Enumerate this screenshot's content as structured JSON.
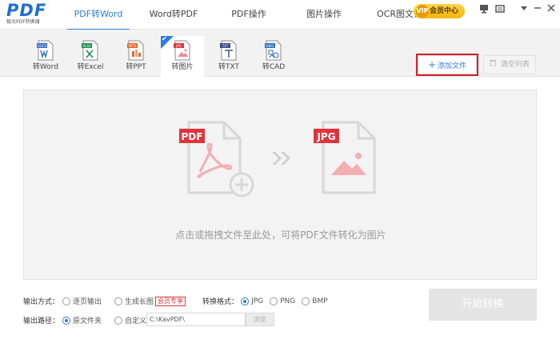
{
  "app": {
    "logo_text": "PDF",
    "logo_sub": "极光PDF转换器"
  },
  "main_tabs": [
    {
      "label": "PDF转Word",
      "active": true
    },
    {
      "label": "Word转PDF",
      "active": false
    },
    {
      "label": "PDF操作",
      "active": false
    },
    {
      "label": "图片操作",
      "active": false
    },
    {
      "label": "OCR图文识别",
      "active": false
    }
  ],
  "vip": {
    "label": "会员中心",
    "icon_text": "VIP"
  },
  "window_controls": {
    "feedback": "▀",
    "message": "✉",
    "menu": "▾",
    "minimize": "—",
    "close": "✕"
  },
  "sub_tabs": [
    {
      "label": "转Word",
      "tag": "DOCX",
      "color": "#2b6cc4",
      "active": false
    },
    {
      "label": "转Excel",
      "tag": "XLSX",
      "color": "#1f8c4a",
      "active": false
    },
    {
      "label": "转PPT",
      "tag": "PPTX",
      "color": "#e06a2b",
      "active": false
    },
    {
      "label": "转图片",
      "tag": "JPG",
      "color": "#e0343c",
      "active": true
    },
    {
      "label": "转TXT",
      "tag": "TXT",
      "color": "#3b4a8a",
      "active": false
    },
    {
      "label": "转CAD",
      "tag": "DWG",
      "color": "#2b6cc4",
      "active": false
    }
  ],
  "toolbar": {
    "add_label": "添加文件",
    "clear_label": "清空列表"
  },
  "drop": {
    "left_tag": "PDF",
    "right_tag": "JPG",
    "hint": "点击或拖拽文件至此处，可将PDF文件转化为图片"
  },
  "options": {
    "output_mode_label": "输出方式：",
    "mode_page": "逐页输出",
    "mode_long": "生成长图",
    "vip_badge": "会员专享",
    "format_label": "转换格式：",
    "format_jpg": "JPG",
    "format_png": "PNG",
    "format_bmp": "BMP",
    "path_label": "输出路径：",
    "path_source": "原文件夹",
    "path_custom": "自定义",
    "path_value": "C:\\KavPDF\\",
    "browse_label": "浏览",
    "start_label": "开始转换"
  },
  "colors": {
    "accent": "#2d7be5",
    "highlight_border": "#d8202a",
    "pdf_red": "#e0343c"
  }
}
